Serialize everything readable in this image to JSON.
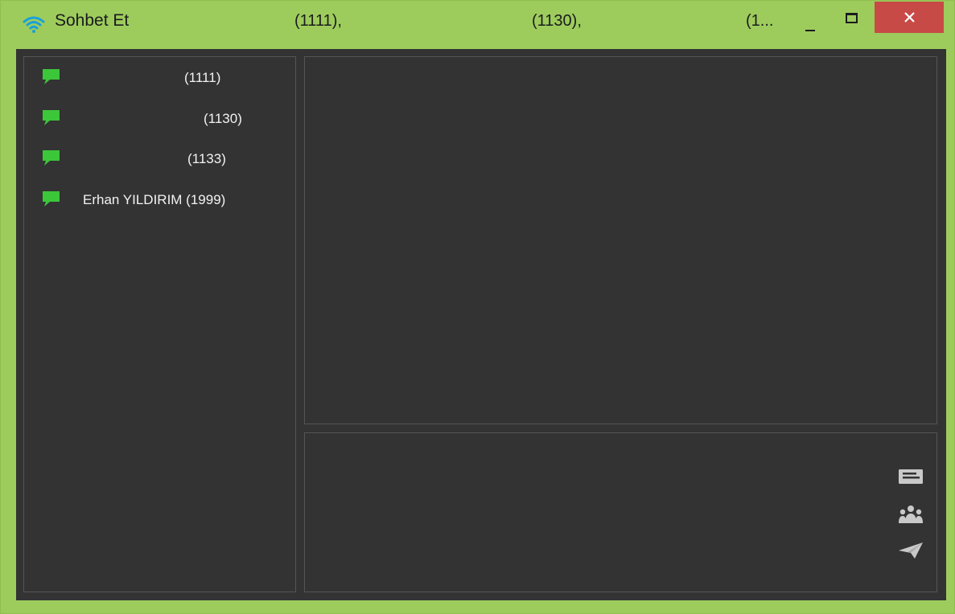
{
  "window": {
    "title": "Sohbet Et",
    "title_contacts": [
      "(1111),",
      "(1130),",
      "(1..."
    ],
    "accent_color": "#9dcc5d",
    "close_color": "#c84a46",
    "background_color": "#333333"
  },
  "contacts": [
    {
      "label": "(1111)",
      "icon": "chat-bubble-icon"
    },
    {
      "label": "(1130)",
      "icon": "chat-bubble-icon"
    },
    {
      "label": "(1133)",
      "icon": "chat-bubble-icon"
    },
    {
      "label": "Erhan YILDIRIM (1999)",
      "icon": "chat-bubble-icon"
    }
  ],
  "toolbar": {
    "icons": [
      "message-icon",
      "group-icon",
      "send-icon"
    ]
  }
}
